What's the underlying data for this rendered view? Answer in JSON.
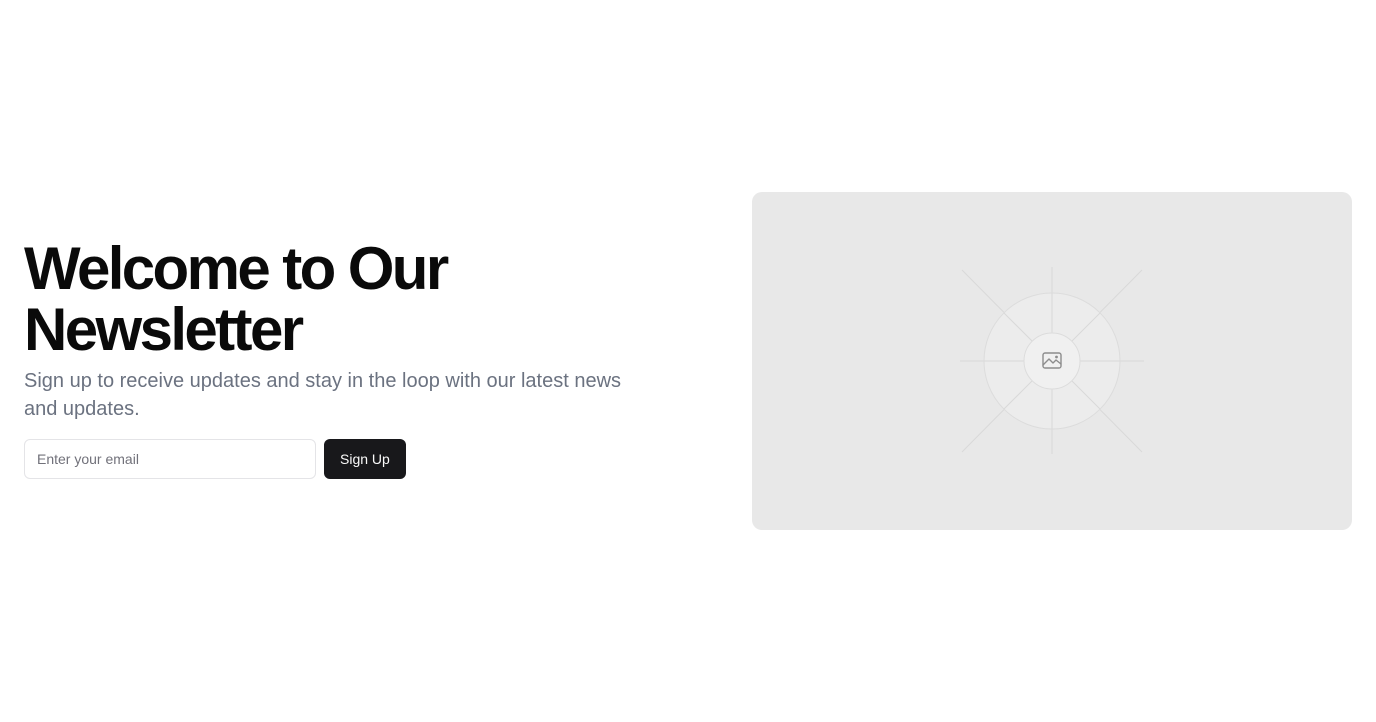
{
  "hero": {
    "title": "Welcome to Our\nNewsletter",
    "subtitle": "Sign up to receive updates and stay in the loop with our latest news and updates."
  },
  "signup": {
    "email_placeholder": "Enter your email",
    "email_value": "",
    "button_label": "Sign Up"
  },
  "media": {
    "icon": "image-icon",
    "background_color": "#e8e8e8"
  },
  "colors": {
    "button_background": "#18181b",
    "subtitle_text": "#6b7280"
  }
}
